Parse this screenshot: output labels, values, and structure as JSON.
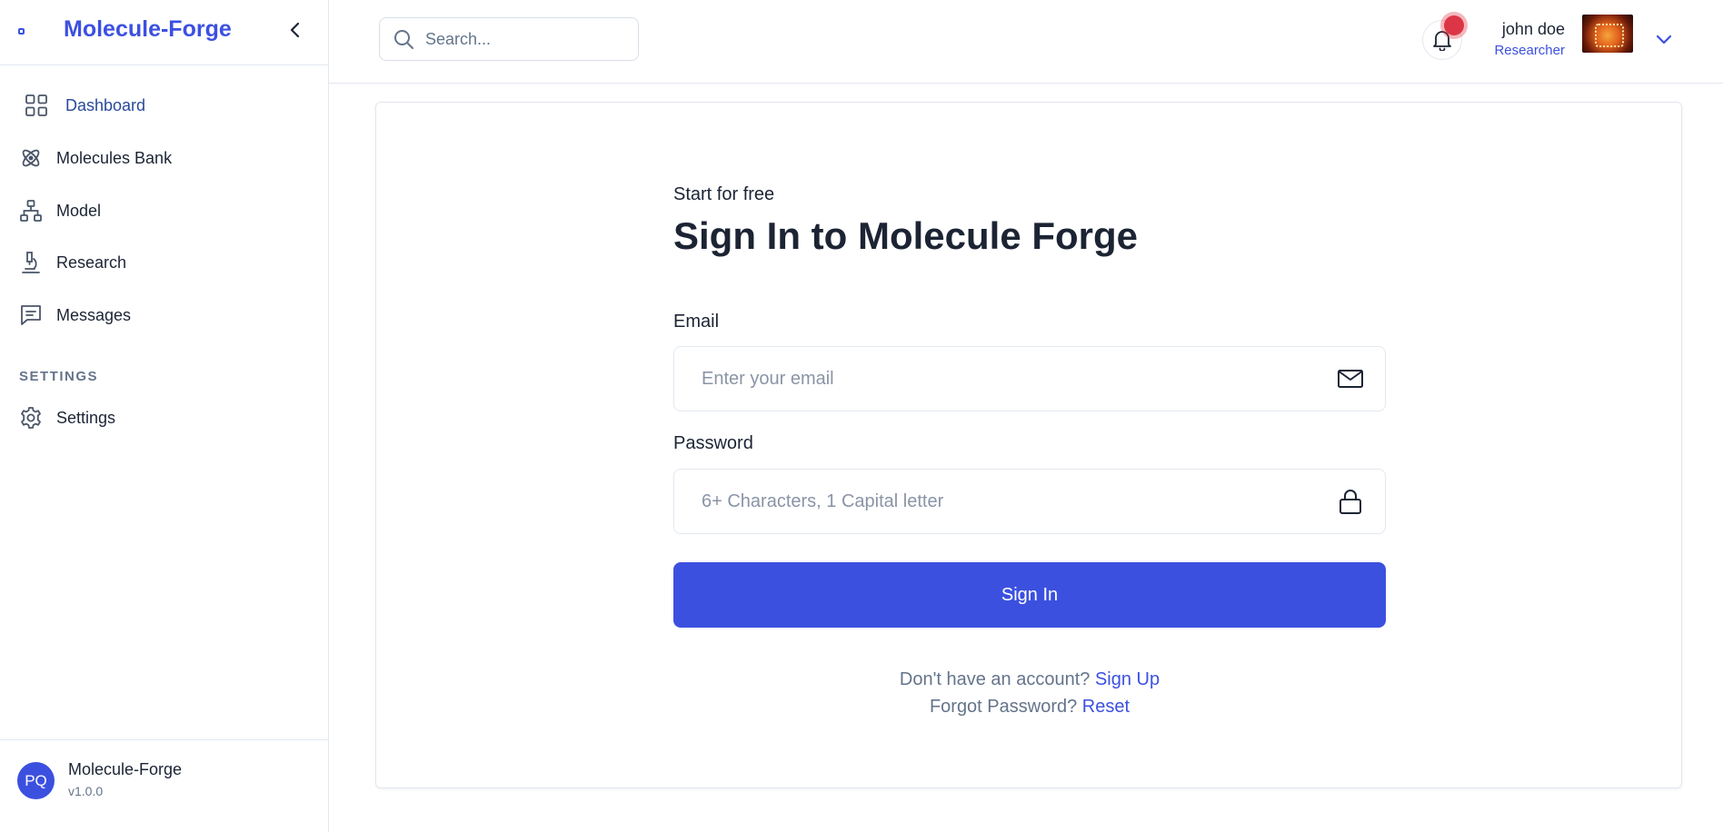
{
  "sidebar": {
    "brand": "Molecule-Forge",
    "items": [
      {
        "label": "Dashboard",
        "icon": "grid-icon"
      },
      {
        "label": "Molecules Bank",
        "icon": "atom-icon"
      },
      {
        "label": "Model",
        "icon": "hierarchy-icon"
      },
      {
        "label": "Research",
        "icon": "microscope-icon"
      },
      {
        "label": "Messages",
        "icon": "message-icon"
      }
    ],
    "settings_heading": "SETTINGS",
    "settings_item": {
      "label": "Settings",
      "icon": "gear-icon"
    },
    "footer": {
      "initials": "PQ",
      "name": "Molecule-Forge",
      "version": "v1.0.0"
    }
  },
  "header": {
    "search_placeholder": "Search...",
    "user": {
      "name": "john doe",
      "role": "Researcher"
    }
  },
  "signin": {
    "subtitle": "Start for free",
    "title": "Sign In to Molecule Forge",
    "email_label": "Email",
    "email_placeholder": "Enter your email",
    "password_label": "Password",
    "password_placeholder": "6+ Characters, 1 Capital letter",
    "button": "Sign In",
    "no_account_text": "Don't have an account?",
    "signup_link": "Sign Up",
    "forgot_text": "Forgot Password?",
    "reset_link": "Reset"
  },
  "colors": {
    "accent": "#3c50e0",
    "text": "#1c2434",
    "muted": "#64748b",
    "notification": "#dc3545"
  }
}
